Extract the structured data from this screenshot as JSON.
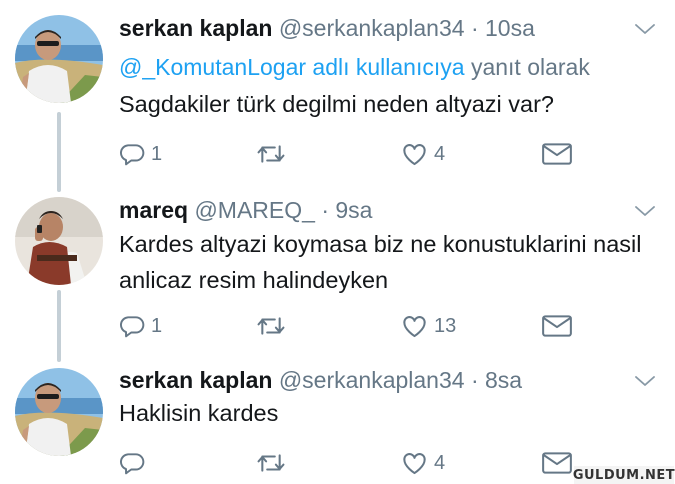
{
  "tweets": [
    {
      "name": "serkan kaplan",
      "handle": "@serkankaplan34",
      "sep": "·",
      "time": "10sa",
      "reply_mention": "@_KomutanLogar adlı kullanıcıya",
      "reply_suffix": "yanıt olarak",
      "text": "Sagdakiler türk degilmi neden altyazi var?",
      "reply_count": "1",
      "retweet_count": "",
      "like_count": "4",
      "avatar_icon": "beach-portrait-avatar"
    },
    {
      "name": "mareq",
      "handle": "@MAREQ_",
      "sep": "·",
      "time": "9sa",
      "text": "Kardes altyazi koymasa biz ne konustuklarini nasil anlicaz resim halindeyken",
      "reply_count": "1",
      "retweet_count": "",
      "like_count": "13",
      "avatar_icon": "man-on-phone-avatar"
    },
    {
      "name": "serkan kaplan",
      "handle": "@serkankaplan34",
      "sep": "·",
      "time": "8sa",
      "text": "Haklisin kardes",
      "reply_count": "",
      "retweet_count": "",
      "like_count": "4",
      "avatar_icon": "beach-portrait-avatar"
    }
  ],
  "icons": {
    "reply": "reply-icon",
    "retweet": "retweet-icon",
    "like": "heart-icon",
    "dm": "envelope-icon",
    "menu": "chevron-down-icon"
  },
  "colors": {
    "link": "#1da1f2",
    "muted": "#657786",
    "text": "#14171a",
    "thread_line": "#c4cfd6"
  },
  "watermark": "GULDUM.NET"
}
